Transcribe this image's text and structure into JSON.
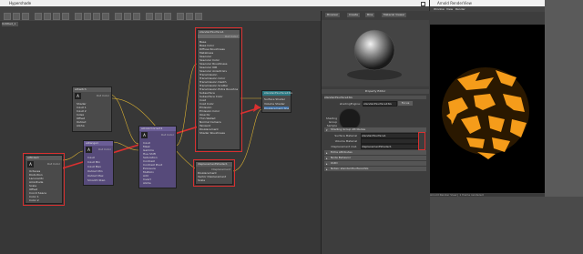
{
  "hypershade": {
    "title": "Hypershade",
    "graph_tab": "Untitled_1",
    "nodes": {
      "top": {
        "name": "standardSurface1",
        "tag": "Out Color",
        "rows": [
          "Base",
          "Base Color",
          "Diffuse Roughness",
          "Metalness",
          "Specular",
          "Specular Color",
          "Specular Roughness",
          "Specular IOR",
          "Specular Anisotropy",
          "Transmission",
          "Transmission Color",
          "Transmission Depth",
          "Transmission Scatter",
          "Transmission Extra Roughness",
          "Subsurface",
          "Subsurface Color",
          "Coat",
          "Coat Color",
          "Emission",
          "Emission Color",
          "Opacity",
          "Thin Walled",
          "Normal Camera",
          "Tangent",
          "Displacement",
          "Shader Roughness"
        ]
      },
      "top_small": {
        "name": "aiSwitch",
        "tag": "Out Color",
        "rows": [
          "Shader",
          "Input 1",
          "Input 2",
          "Index",
          "Offset",
          "Output",
          "Alpha"
        ]
      },
      "left": {
        "name": "aiNoise1",
        "tag": "Out Color",
        "rows": [
          "Octaves",
          "Distortion",
          "Lacunarity",
          "Amplitude",
          "Scale",
          "Offset",
          "Coord Space",
          "Pref Name",
          "Time",
          "Color 1",
          "Color 2"
        ]
      },
      "mid": {
        "name": "aiRange1",
        "tag": "Out Color",
        "rows": [
          "Input",
          "Input Min",
          "Input Max",
          "Output Min",
          "Output Max",
          "Smooth Step"
        ]
      },
      "center": {
        "name": "aiColorCorrect1",
        "tag": "Out Color",
        "rows": [
          "Input",
          "Mask",
          "Gamma",
          "Hue Shift",
          "Saturation",
          "Contrast",
          "Contrast Pivot",
          "Exposure",
          "Multiply",
          "Add",
          "Invert",
          "Alpha"
        ]
      },
      "right": {
        "name": "standardSurface1SG",
        "rows": [
          "Surface Shader",
          "Volume Shader",
          "Displacement Shader"
        ]
      },
      "bottom": {
        "name": "displacementShader1",
        "tag": "Displacement",
        "rows": [
          "Displacement",
          "Vector Displacement",
          "Scale",
          "Tangent"
        ]
      }
    }
  },
  "attribute_editor": {
    "tabs": [
      "Browser",
      "Create",
      "Bins",
      "Material Viewer"
    ],
    "panel_title": "Property Editor",
    "node_label": "standardSurface1SG",
    "shading_group_label": "shadingEngine:",
    "shading_group_value": "standardSurface1SG",
    "focus_button": "Focus",
    "sample_label": "Shading Group Sample",
    "sections": [
      "Shading Group Attributes",
      "Extra Attributes",
      "Node Behavior",
      "UUID",
      "Notes: standardSurface1SG"
    ],
    "fields": [
      {
        "label": "Surface Material",
        "value": "standardSurface1"
      },
      {
        "label": "Volume Material",
        "value": ""
      },
      {
        "label": "Displacement mat.",
        "value": "displacementShader1"
      }
    ]
  },
  "render_view": {
    "title": "Arnold RenderView",
    "menus": [
      "Window",
      "View",
      "Render"
    ],
    "status": "Arnold Render View  |  1 frame rendered"
  },
  "colors": {
    "highlight": "#d93030",
    "render_orange": "#f59c1a",
    "connection": "#d9b032"
  }
}
